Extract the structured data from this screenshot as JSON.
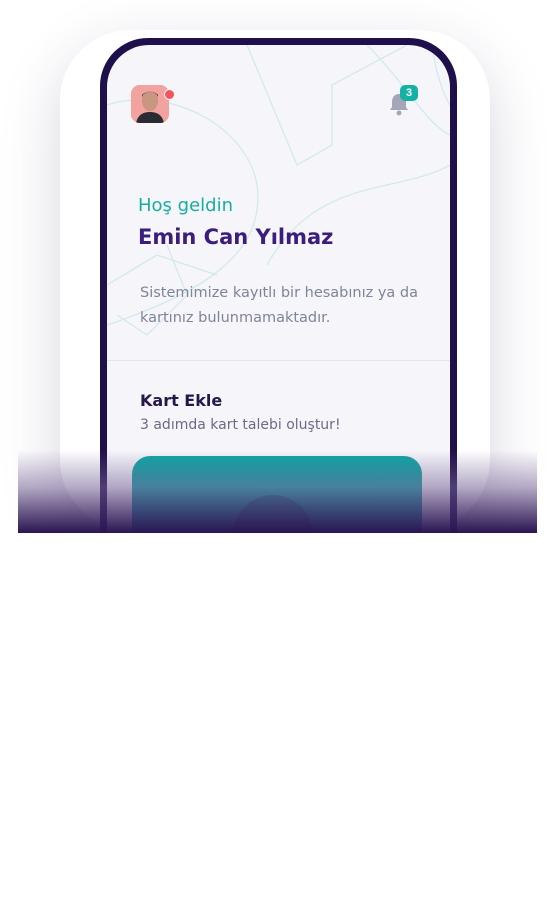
{
  "header": {
    "avatar_icon": "user-avatar-icon",
    "bell_icon": "bell-icon",
    "notification_count": "3",
    "colors": {
      "badge": "#14b2a4",
      "avatar_dot": "#f4555a"
    }
  },
  "welcome": {
    "greeting": "Hoş geldin",
    "name": "Emin Can Yılmaz",
    "message": "Sistemimize kayıtlı bir hesabınız ya da kartınız bulunmamaktadır."
  },
  "add_card": {
    "title": "Kart Ekle",
    "subtitle": "3 adımda kart talebi oluştur!"
  },
  "colors": {
    "accent": "#17aea1",
    "primary": "#3b1d7c",
    "phone_frame": "#1f0f4a",
    "card": "#0aa6a3"
  }
}
